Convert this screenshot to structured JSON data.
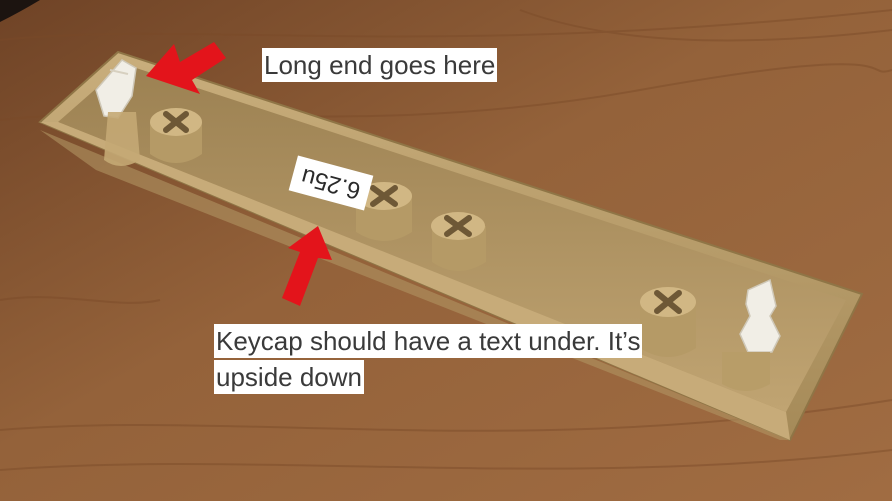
{
  "annotations": {
    "long_end_label": "Long end goes here",
    "keycap_label_line1": "Keycap should have a text under. It’s",
    "keycap_label_line2": "upside down",
    "size_marking": "6.25u"
  },
  "colors": {
    "table_wood": "#8a5a34",
    "keycap_tan": "#b69a66",
    "arrow_red": "#e3141b",
    "stabilizer_white": "#f1eee6"
  },
  "icons": {
    "arrow_top": "red-arrow-icon",
    "arrow_bottom": "red-arrow-icon"
  }
}
